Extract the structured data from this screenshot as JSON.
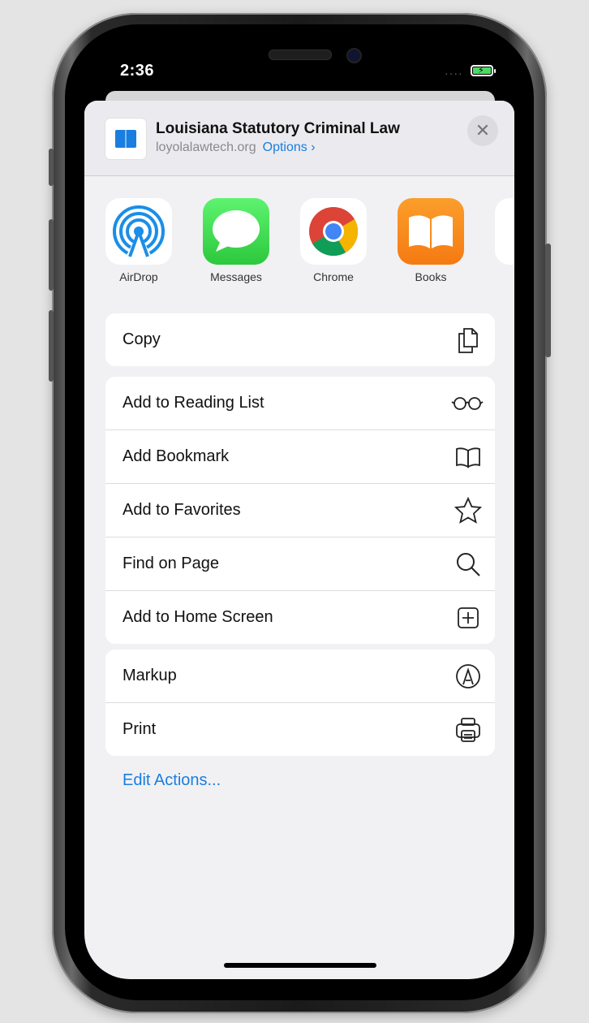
{
  "status_bar": {
    "time": "2:36",
    "signal": "····"
  },
  "share_header": {
    "title": "Louisiana Statutory Criminal Law",
    "domain": "loyolalawtech.org",
    "options_label": "Options ›",
    "close_label": "✕"
  },
  "apps": [
    {
      "label": "AirDrop",
      "icon": "airdrop-icon"
    },
    {
      "label": "Messages",
      "icon": "messages-icon"
    },
    {
      "label": "Chrome",
      "icon": "chrome-icon"
    },
    {
      "label": "Books",
      "icon": "books-icon"
    }
  ],
  "actions": {
    "copy": {
      "label": "Copy",
      "icon": "copy-icon"
    },
    "reading_list": {
      "label": "Add to Reading List",
      "icon": "glasses-icon"
    },
    "bookmark": {
      "label": "Add Bookmark",
      "icon": "book-icon"
    },
    "favorites": {
      "label": "Add to Favorites",
      "icon": "star-icon"
    },
    "find": {
      "label": "Find on Page",
      "icon": "search-icon"
    },
    "home_screen": {
      "label": "Add to Home Screen",
      "icon": "plus-square-icon"
    },
    "markup": {
      "label": "Markup",
      "icon": "markup-icon"
    },
    "print": {
      "label": "Print",
      "icon": "printer-icon"
    }
  },
  "edit_actions_label": "Edit Actions...",
  "colors": {
    "accent": "#1a7de0",
    "sheet_bg": "#f1f1f4",
    "battery": "#4cd964"
  }
}
